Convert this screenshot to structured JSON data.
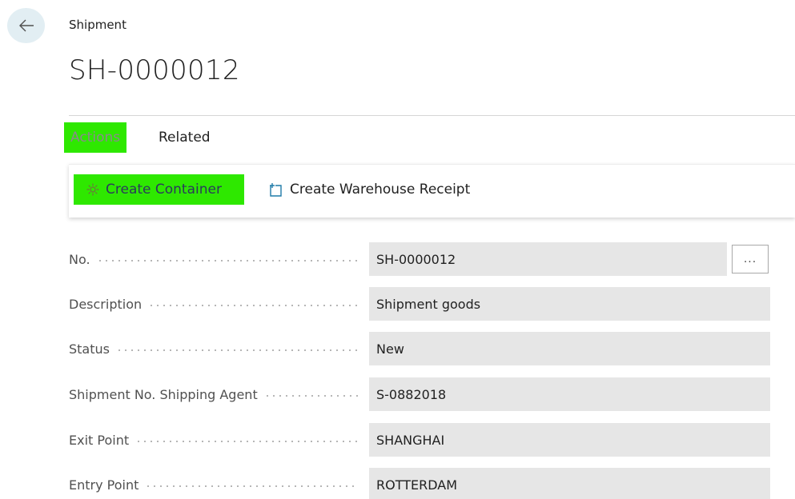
{
  "header": {
    "breadcrumb": "Shipment",
    "title": "SH-0000012"
  },
  "action_tabs": {
    "actions": "Actions",
    "related": "Related"
  },
  "actions": {
    "create_container": "Create Container",
    "create_warehouse_receipt": "Create Warehouse Receipt"
  },
  "fields": [
    {
      "label": "No.",
      "value": "SH-0000012"
    },
    {
      "label": "Description",
      "value": "Shipment goods"
    },
    {
      "label": "Status",
      "value": "New"
    },
    {
      "label": "Shipment No. Shipping Agent",
      "value": "S-0882018"
    },
    {
      "label": "Exit Point",
      "value": "SHANGHAI"
    },
    {
      "label": "Entry Point",
      "value": "ROTTERDAM"
    }
  ],
  "assist_button": "...",
  "colors": {
    "highlight": "#2ee800",
    "field_bg": "#e6e6e6",
    "back_button_bg": "#e2eef3"
  },
  "icons": {
    "back": "arrow-left-icon",
    "create_container": "gear-icon",
    "create_warehouse_receipt": "new-document-icon"
  }
}
